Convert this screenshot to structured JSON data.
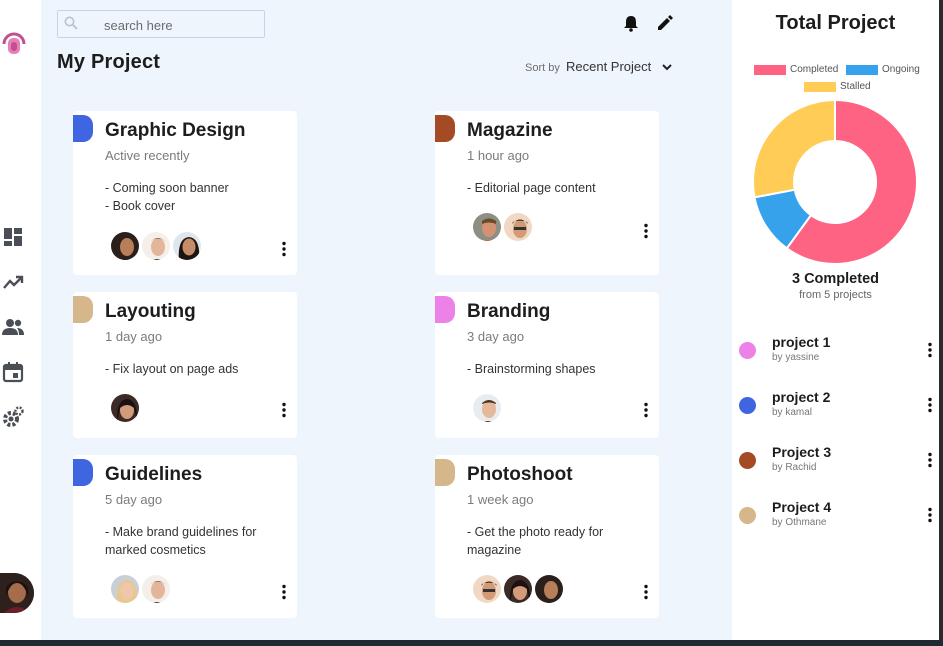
{
  "search": {
    "placeholder": "search here"
  },
  "main": {
    "title": "My Project",
    "sort_by_label": "Sort by",
    "sort_value": "Recent Project"
  },
  "cards": [
    {
      "title": "Graphic Design",
      "time": "Active recently",
      "notes": [
        "- Coming soon banner",
        "- Book cover"
      ],
      "tag_color": "#3f66e0"
    },
    {
      "title": "Magazine",
      "time": "1 hour ago",
      "notes": [
        "- Editorial page content"
      ],
      "tag_color": "#a44b25"
    },
    {
      "title": "Layouting",
      "time": "1 day ago",
      "notes": [
        "- Fix layout on page ads"
      ],
      "tag_color": "#d6b68b"
    },
    {
      "title": "Branding",
      "time": "3 day ago",
      "notes": [
        "- Brainstorming shapes"
      ],
      "tag_color": "#ec82e8"
    },
    {
      "title": "Guidelines",
      "time": "5 day ago",
      "notes": [
        "- Make brand guidelines for marked cosmetics"
      ],
      "tag_color": "#3f66e0"
    },
    {
      "title": "Photoshoot",
      "time": "1 week ago",
      "notes": [
        "- Get the photo ready for magazine"
      ],
      "tag_color": "#d6b68b"
    }
  ],
  "panel": {
    "title": "Total Project",
    "legend": [
      {
        "label": "Completed",
        "color": "#ff6384"
      },
      {
        "label": "Ongoing",
        "color": "#36a2eb"
      },
      {
        "label": "Stalled",
        "color": "#ffcd56"
      }
    ],
    "count_label": "3 Completed",
    "count_sub": "from 5 projects",
    "projects": [
      {
        "name": "project 1",
        "by": "by yassine",
        "color": "#ec82e8"
      },
      {
        "name": "project 2",
        "by": "by kamal",
        "color": "#3f66e0"
      },
      {
        "name": "Project 3",
        "by": "by Rachid",
        "color": "#a44b25"
      },
      {
        "name": "Project 4",
        "by": "by Othmane",
        "color": "#d6b68b"
      }
    ]
  },
  "chart_data": {
    "type": "pie",
    "donut": true,
    "categories": [
      "Completed",
      "Ongoing",
      "Stalled"
    ],
    "values": [
      3,
      0.6,
      1.4
    ],
    "legend_position": "top"
  },
  "icons": {
    "logo": "brand-logo-icon",
    "nav": [
      "dashboard-icon",
      "trending-icon",
      "people-icon",
      "calendar-icon",
      "settings-icon"
    ],
    "top": [
      "bell-icon",
      "edit-icon"
    ]
  }
}
